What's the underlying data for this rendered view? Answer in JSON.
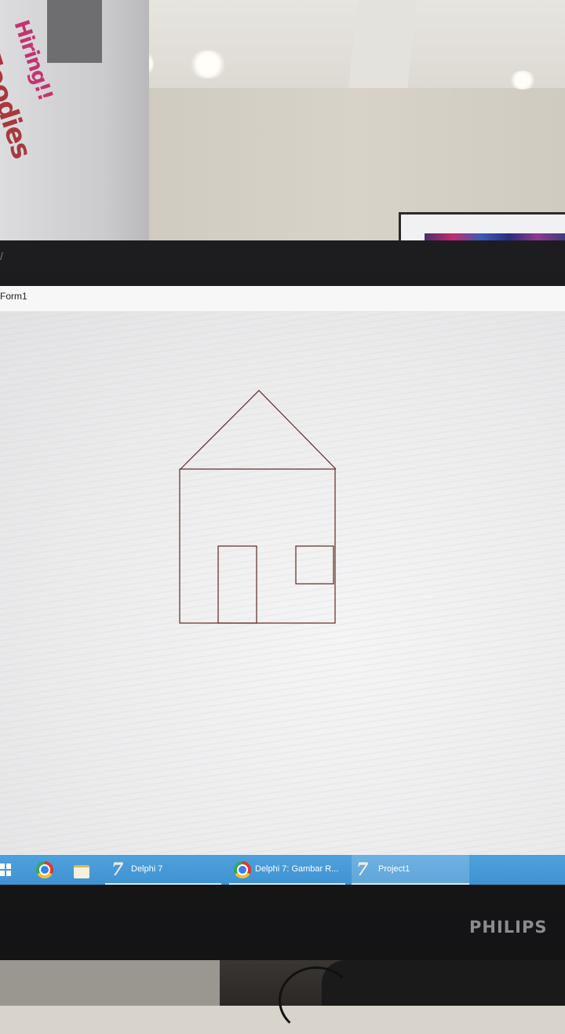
{
  "environment": {
    "sign_line1": "Hiring!!",
    "sign_line2": "Foodies",
    "monitor_brand": "PHILIPS"
  },
  "window": {
    "title": "Form1"
  },
  "drawing": {
    "description_shapes": [
      "roof-triangle",
      "house-body",
      "door",
      "window"
    ],
    "stroke_color": "#5b2b22"
  },
  "taskbar": {
    "items": [
      {
        "label": "Delphi 7",
        "icon": "delphi-icon"
      },
      {
        "label": "Delphi 7: Gambar R...",
        "icon": "chrome-icon"
      },
      {
        "label": "Project1",
        "icon": "delphi-icon"
      }
    ],
    "pinned": [
      "windows-start-icon",
      "chrome-icon",
      "file-explorer-icon"
    ]
  },
  "colors": {
    "taskbar": "#4499d7",
    "bezel": "#1a1a1b",
    "canvas": "#f1f0f1"
  }
}
